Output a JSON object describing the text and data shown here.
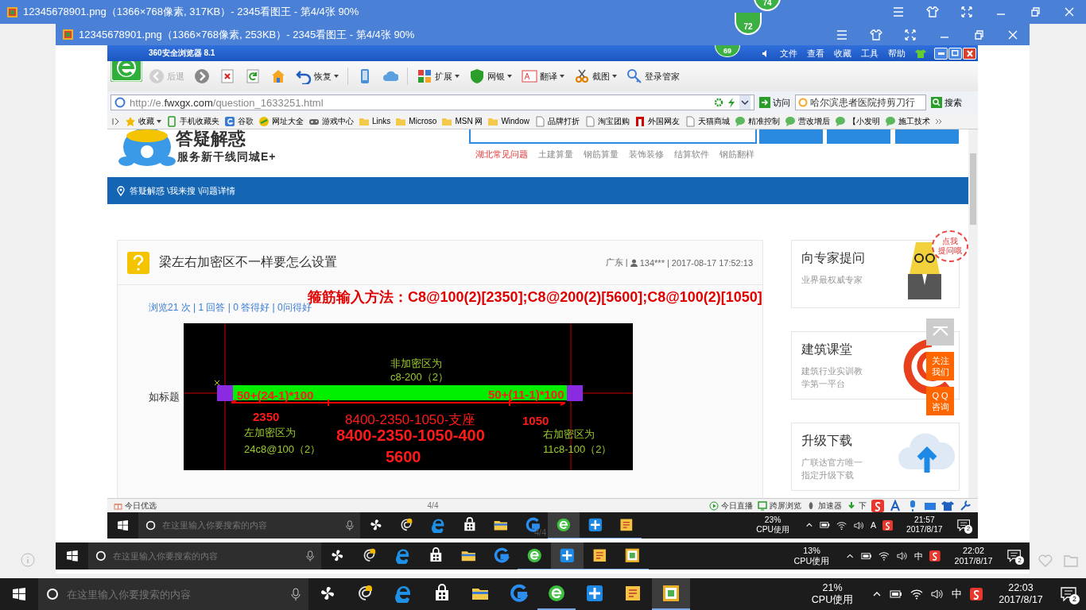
{
  "outer_window": {
    "title": "12345678901.png（1366×768像素, 317KB）- 2345看图王 - 第4/4张 90%",
    "badge": "74"
  },
  "inner_window": {
    "title": "12345678901.png（1366×768像素, 253KB）- 2345看图王 - 第4/4张 90%",
    "badge": "72",
    "page_counter": "4/4"
  },
  "browser": {
    "title": "360安全浏览器 8.1",
    "badge": "69",
    "menu": [
      "文件",
      "查看",
      "收藏",
      "工具",
      "帮助"
    ],
    "toolbar": [
      {
        "kind": "back",
        "label": "后退",
        "disabled": true,
        "dropdown": false
      },
      {
        "kind": "forward",
        "disabled": false,
        "dropdown": false
      },
      {
        "kind": "stop",
        "disabled": false,
        "dropdown": false
      },
      {
        "kind": "refresh",
        "disabled": false,
        "dropdown": false
      },
      {
        "kind": "home",
        "disabled": false,
        "dropdown": false
      },
      {
        "kind": "undo",
        "label": "恢复",
        "disabled": false,
        "dropdown": true
      },
      {
        "kind": "phone",
        "disabled": false,
        "dropdown": false
      },
      {
        "kind": "cloud",
        "disabled": false,
        "dropdown": false
      },
      {
        "kind": "grid",
        "label": "扩展",
        "disabled": false,
        "dropdown": true
      },
      {
        "kind": "shield",
        "label": "网银",
        "disabled": false,
        "dropdown": true
      },
      {
        "kind": "translate",
        "label": "翻译",
        "disabled": false,
        "dropdown": true
      },
      {
        "kind": "scissors",
        "label": "截图",
        "disabled": false,
        "dropdown": true
      },
      {
        "kind": "key",
        "label": "登录管家",
        "disabled": false,
        "dropdown": false
      }
    ],
    "address": "http://e.**fwxgx.com**/question_1633251.html",
    "go_button": "访问",
    "search_value": "哈尔滨患者医院持剪刀行",
    "search_button": "搜索",
    "bookmarks": [
      {
        "kind": "star",
        "label": "收藏"
      },
      {
        "kind": "phone",
        "label": "手机收藏夹"
      },
      {
        "kind": "google",
        "label": "谷歌"
      },
      {
        "kind": "globe",
        "label": "网址大全"
      },
      {
        "kind": "game",
        "label": "游戏中心"
      },
      {
        "kind": "folder",
        "label": "Links"
      },
      {
        "kind": "folder",
        "label": "Microso"
      },
      {
        "kind": "folder",
        "label": "MSN 网"
      },
      {
        "kind": "folder",
        "label": "Window"
      },
      {
        "kind": "page",
        "label": "品牌打折"
      },
      {
        "kind": "page",
        "label": "淘宝团购"
      },
      {
        "kind": "flag",
        "label": "外国网友"
      },
      {
        "kind": "page",
        "label": "天猫商城"
      },
      {
        "kind": "chat",
        "label": "精准控制"
      },
      {
        "kind": "chat",
        "label": "营改增后"
      },
      {
        "kind": "chat",
        "label": "【小发明"
      },
      {
        "kind": "chat",
        "label": "施工技术"
      }
    ],
    "status_bar": {
      "left": "今日优选",
      "center": "4/4",
      "items": [
        "今日直播",
        "跨屏浏览",
        "加速器",
        "下"
      ]
    }
  },
  "page": {
    "logo_title": "答疑解惑",
    "slogan": "服务新干线同城E+",
    "nav_links": [
      {
        "label": "湖北常见问题",
        "selected": true
      },
      {
        "label": "土建算量",
        "selected": false
      },
      {
        "label": "钢筋算量",
        "selected": false
      },
      {
        "label": "装饰装修",
        "selected": false
      },
      {
        "label": "结算软件",
        "selected": false
      },
      {
        "label": "钢筋翻样",
        "selected": false
      }
    ],
    "breadcrumb": "答疑解惑 \\我来搜 \\问题详情",
    "question": {
      "title": "梁左右加密区不一样要怎么设置",
      "location": "广东 |",
      "user": "134***",
      "time": "| 2017-08-17 17:52:13",
      "stats": "浏览21 次 | 1 回答 | 0 答得好 | 0问得好",
      "body": "如标题"
    },
    "overlay_note": "箍筋输入方法：C8@100(2)[2350];C8@200(2)[5600];C8@100(2)[1050]",
    "cad_labels": [
      {
        "kind": "note",
        "text": "非加密区为"
      },
      {
        "kind": "note",
        "text": "c8-200（2）"
      },
      {
        "kind": "dim",
        "text": "50+(24-1)*100"
      },
      {
        "kind": "dim",
        "text": "50+(11-1)*100"
      },
      {
        "kind": "dim",
        "text": "2350"
      },
      {
        "kind": "formula",
        "text": "8400-2350-1050-支座"
      },
      {
        "kind": "dim",
        "text": "1050"
      },
      {
        "kind": "note",
        "text": "左加密区为"
      },
      {
        "kind": "big",
        "text": "8400-2350-1050-400"
      },
      {
        "kind": "note",
        "text": "右加密区为"
      },
      {
        "kind": "note",
        "text": "24c8@100（2）"
      },
      {
        "kind": "big",
        "text": "5600"
      },
      {
        "kind": "note",
        "text": "11c8-100（2）"
      }
    ],
    "sidebar": [
      {
        "kind": "mascot",
        "title": "向专家提问",
        "lines": [
          "业界最权威专家"
        ]
      },
      {
        "kind": "swirl",
        "title": "建筑课堂",
        "lines": [
          "建筑行业实训教",
          "学第一平台"
        ]
      },
      {
        "kind": "cloud",
        "title": "升级下载",
        "lines": [
          "广联达官方唯一",
          "指定升级下载"
        ]
      }
    ],
    "bubble": [
      "点我",
      "提问哦"
    ],
    "follow_button": [
      "关注",
      "我们"
    ],
    "qq_button": [
      "Q Q",
      "咨询"
    ]
  },
  "taskbars": [
    {
      "placeholder": "在这里输入你要搜索的内容",
      "cpu": "23%",
      "cpu_label": "CPU使用",
      "ime": "A",
      "time": "21:57",
      "date": "2017/8/17",
      "notifications": "2",
      "apps": [
        {
          "kind": "fan",
          "running": false,
          "active": false
        },
        {
          "kind": "swirl",
          "running": false,
          "active": false
        },
        {
          "kind": "edge",
          "running": false,
          "active": false
        },
        {
          "kind": "store",
          "running": false,
          "active": false
        },
        {
          "kind": "folder",
          "running": false,
          "active": false
        },
        {
          "kind": "g",
          "running": false,
          "active": false
        },
        {
          "kind": "e360",
          "running": true,
          "active": true
        },
        {
          "kind": "plus",
          "running": true,
          "active": false
        },
        {
          "kind": "notes",
          "running": true,
          "active": false
        }
      ]
    },
    {
      "placeholder": "在这里输入你要搜索的内容",
      "cpu": "13%",
      "cpu_label": "CPU使用",
      "ime": "中",
      "time": "22:02",
      "date": "2017/8/17",
      "notifications": "2",
      "apps": [
        {
          "kind": "fan",
          "running": false,
          "active": false
        },
        {
          "kind": "swirl",
          "running": false,
          "active": false
        },
        {
          "kind": "edge",
          "running": false,
          "active": false
        },
        {
          "kind": "store",
          "running": false,
          "active": false
        },
        {
          "kind": "folder",
          "running": false,
          "active": false
        },
        {
          "kind": "g",
          "running": false,
          "active": false
        },
        {
          "kind": "e360",
          "running": true,
          "active": false
        },
        {
          "kind": "plus",
          "running": true,
          "active": true
        },
        {
          "kind": "notes",
          "running": true,
          "active": false
        },
        {
          "kind": "viewer",
          "running": true,
          "active": false
        }
      ]
    },
    {
      "placeholder": "在这里输入你要搜索的内容",
      "cpu": "21%",
      "cpu_label": "CPU使用",
      "ime": "中",
      "time": "22:03",
      "date": "2017/8/17",
      "notifications": "2",
      "apps": [
        {
          "kind": "fan",
          "running": false,
          "active": false
        },
        {
          "kind": "swirl",
          "running": false,
          "active": false
        },
        {
          "kind": "edge",
          "running": false,
          "active": false
        },
        {
          "kind": "store",
          "running": false,
          "active": false
        },
        {
          "kind": "folder",
          "running": false,
          "active": false
        },
        {
          "kind": "g",
          "running": false,
          "active": false
        },
        {
          "kind": "e360",
          "running": true,
          "active": false
        },
        {
          "kind": "plus",
          "running": false,
          "active": false
        },
        {
          "kind": "notes",
          "running": false,
          "active": false
        },
        {
          "kind": "viewer",
          "running": true,
          "active": true
        }
      ]
    }
  ]
}
